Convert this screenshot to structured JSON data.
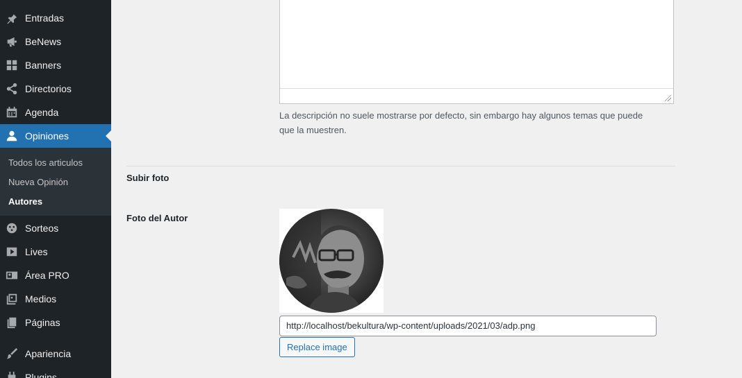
{
  "sidebar": {
    "items": [
      {
        "label": "Entradas",
        "icon": "pin-icon"
      },
      {
        "label": "BeNews",
        "icon": "megaphone-icon"
      },
      {
        "label": "Banners",
        "icon": "grid-icon"
      },
      {
        "label": "Directorios",
        "icon": "share-icon"
      },
      {
        "label": "Agenda",
        "icon": "calendar-icon"
      },
      {
        "label": "Opiniones",
        "icon": "user-icon",
        "active": true
      },
      {
        "label": "Sorteos",
        "icon": "sorteos-icon"
      },
      {
        "label": "Lives",
        "icon": "video-icon"
      },
      {
        "label": "Área PRO",
        "icon": "id-card-icon"
      },
      {
        "label": "Medios",
        "icon": "media-icon"
      },
      {
        "label": "Páginas",
        "icon": "pages-icon"
      },
      {
        "label": "Apariencia",
        "icon": "brush-icon"
      },
      {
        "label": "Plugins",
        "icon": "plugin-icon"
      }
    ],
    "submenu": [
      {
        "label": "Todos los articulos"
      },
      {
        "label": "Nueva Opinión"
      },
      {
        "label": "Autores",
        "current": true
      }
    ]
  },
  "main": {
    "description": "La descripción no suele mostrarse por defecto, sin embargo hay algunos temas que puede que la muestren.",
    "section_title": "Subir foto",
    "photo_label": "Foto del Autor",
    "photo_url": "http://localhost/bekultura/wp-content/uploads/2021/03/adp.png",
    "replace_button": "Replace image"
  },
  "colors": {
    "sidebar_bg": "#1d2327",
    "submenu_bg": "#2c3338",
    "accent": "#2271b1",
    "page_bg": "#f0f0f1"
  }
}
